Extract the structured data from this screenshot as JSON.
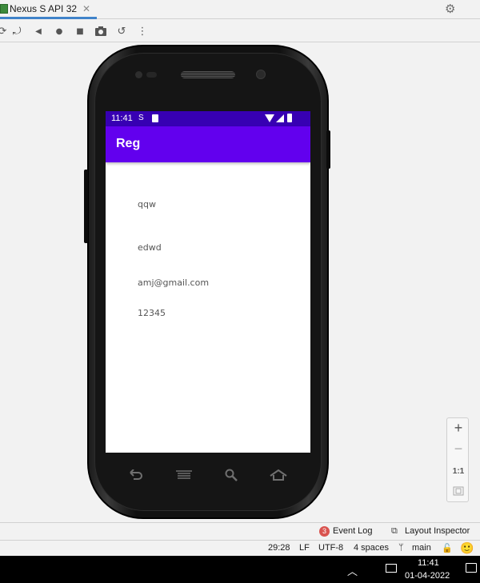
{
  "ide": {
    "tab": {
      "label": "Nexus S API 32",
      "close": "✕"
    },
    "settings_icon": "gear-icon",
    "hide_icon": "minus-icon"
  },
  "emulator_toolbar": {
    "buttons": [
      {
        "name": "power-icon",
        "glyph": "⟳"
      },
      {
        "name": "rotate-icon",
        "glyph": "⤾"
      },
      {
        "name": "back-icon",
        "glyph": "◀"
      },
      {
        "name": "home-icon",
        "glyph": "●"
      },
      {
        "name": "overview-icon",
        "glyph": "■"
      },
      {
        "name": "camera-icon",
        "glyph": "📷"
      },
      {
        "name": "snapshot-icon",
        "glyph": "↺"
      },
      {
        "name": "more-icon",
        "glyph": "⋮"
      }
    ]
  },
  "device": {
    "status_bar": {
      "time": "11:41",
      "sim_icon": "S",
      "colors": {
        "bg": "#3700b3"
      }
    },
    "app": {
      "title": "Reg",
      "accent": "#6200ee",
      "fields": [
        "qqw",
        "edwd",
        "amj@gmail.com",
        "12345"
      ]
    },
    "nav_keys": [
      {
        "name": "back-key-icon",
        "glyph": "↩"
      },
      {
        "name": "menu-key-icon",
        "glyph": "≡"
      },
      {
        "name": "search-key-icon",
        "glyph": "⌕"
      },
      {
        "name": "home-key-icon",
        "glyph": "⌂"
      }
    ]
  },
  "zoom_panel": {
    "zoom_in": "+",
    "zoom_out": "−",
    "actual": "1:1",
    "fit_icon": "fit-screen-icon"
  },
  "tool_windows": {
    "event_log": {
      "badge": "3",
      "label": "Event Log"
    },
    "layout_inspector": {
      "label": "Layout Inspector"
    }
  },
  "status": {
    "position": "29:28",
    "line_sep": "LF",
    "encoding": "UTF-8",
    "indent": "4 spaces",
    "branch": "main"
  },
  "taskbar": {
    "time": "11:41",
    "date": "01-04-2022"
  }
}
